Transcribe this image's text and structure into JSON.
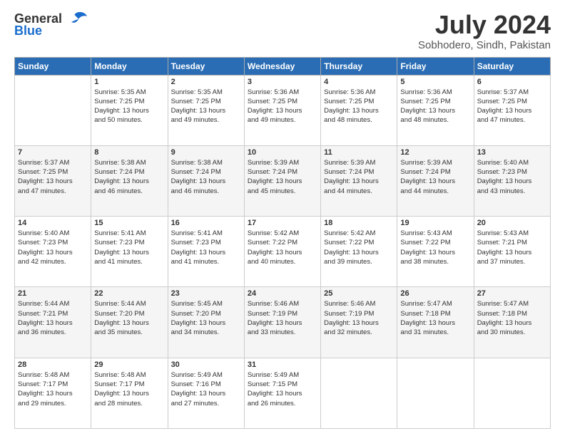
{
  "logo": {
    "general": "General",
    "blue": "Blue"
  },
  "title": {
    "month_year": "July 2024",
    "location": "Sobhodero, Sindh, Pakistan"
  },
  "weekdays": [
    "Sunday",
    "Monday",
    "Tuesday",
    "Wednesday",
    "Thursday",
    "Friday",
    "Saturday"
  ],
  "weeks": [
    [
      {
        "day": "",
        "info": ""
      },
      {
        "day": "1",
        "info": "Sunrise: 5:35 AM\nSunset: 7:25 PM\nDaylight: 13 hours\nand 50 minutes."
      },
      {
        "day": "2",
        "info": "Sunrise: 5:35 AM\nSunset: 7:25 PM\nDaylight: 13 hours\nand 49 minutes."
      },
      {
        "day": "3",
        "info": "Sunrise: 5:36 AM\nSunset: 7:25 PM\nDaylight: 13 hours\nand 49 minutes."
      },
      {
        "day": "4",
        "info": "Sunrise: 5:36 AM\nSunset: 7:25 PM\nDaylight: 13 hours\nand 48 minutes."
      },
      {
        "day": "5",
        "info": "Sunrise: 5:36 AM\nSunset: 7:25 PM\nDaylight: 13 hours\nand 48 minutes."
      },
      {
        "day": "6",
        "info": "Sunrise: 5:37 AM\nSunset: 7:25 PM\nDaylight: 13 hours\nand 47 minutes."
      }
    ],
    [
      {
        "day": "7",
        "info": "Sunrise: 5:37 AM\nSunset: 7:25 PM\nDaylight: 13 hours\nand 47 minutes."
      },
      {
        "day": "8",
        "info": "Sunrise: 5:38 AM\nSunset: 7:24 PM\nDaylight: 13 hours\nand 46 minutes."
      },
      {
        "day": "9",
        "info": "Sunrise: 5:38 AM\nSunset: 7:24 PM\nDaylight: 13 hours\nand 46 minutes."
      },
      {
        "day": "10",
        "info": "Sunrise: 5:39 AM\nSunset: 7:24 PM\nDaylight: 13 hours\nand 45 minutes."
      },
      {
        "day": "11",
        "info": "Sunrise: 5:39 AM\nSunset: 7:24 PM\nDaylight: 13 hours\nand 44 minutes."
      },
      {
        "day": "12",
        "info": "Sunrise: 5:39 AM\nSunset: 7:24 PM\nDaylight: 13 hours\nand 44 minutes."
      },
      {
        "day": "13",
        "info": "Sunrise: 5:40 AM\nSunset: 7:23 PM\nDaylight: 13 hours\nand 43 minutes."
      }
    ],
    [
      {
        "day": "14",
        "info": "Sunrise: 5:40 AM\nSunset: 7:23 PM\nDaylight: 13 hours\nand 42 minutes."
      },
      {
        "day": "15",
        "info": "Sunrise: 5:41 AM\nSunset: 7:23 PM\nDaylight: 13 hours\nand 41 minutes."
      },
      {
        "day": "16",
        "info": "Sunrise: 5:41 AM\nSunset: 7:23 PM\nDaylight: 13 hours\nand 41 minutes."
      },
      {
        "day": "17",
        "info": "Sunrise: 5:42 AM\nSunset: 7:22 PM\nDaylight: 13 hours\nand 40 minutes."
      },
      {
        "day": "18",
        "info": "Sunrise: 5:42 AM\nSunset: 7:22 PM\nDaylight: 13 hours\nand 39 minutes."
      },
      {
        "day": "19",
        "info": "Sunrise: 5:43 AM\nSunset: 7:22 PM\nDaylight: 13 hours\nand 38 minutes."
      },
      {
        "day": "20",
        "info": "Sunrise: 5:43 AM\nSunset: 7:21 PM\nDaylight: 13 hours\nand 37 minutes."
      }
    ],
    [
      {
        "day": "21",
        "info": "Sunrise: 5:44 AM\nSunset: 7:21 PM\nDaylight: 13 hours\nand 36 minutes."
      },
      {
        "day": "22",
        "info": "Sunrise: 5:44 AM\nSunset: 7:20 PM\nDaylight: 13 hours\nand 35 minutes."
      },
      {
        "day": "23",
        "info": "Sunrise: 5:45 AM\nSunset: 7:20 PM\nDaylight: 13 hours\nand 34 minutes."
      },
      {
        "day": "24",
        "info": "Sunrise: 5:46 AM\nSunset: 7:19 PM\nDaylight: 13 hours\nand 33 minutes."
      },
      {
        "day": "25",
        "info": "Sunrise: 5:46 AM\nSunset: 7:19 PM\nDaylight: 13 hours\nand 32 minutes."
      },
      {
        "day": "26",
        "info": "Sunrise: 5:47 AM\nSunset: 7:18 PM\nDaylight: 13 hours\nand 31 minutes."
      },
      {
        "day": "27",
        "info": "Sunrise: 5:47 AM\nSunset: 7:18 PM\nDaylight: 13 hours\nand 30 minutes."
      }
    ],
    [
      {
        "day": "28",
        "info": "Sunrise: 5:48 AM\nSunset: 7:17 PM\nDaylight: 13 hours\nand 29 minutes."
      },
      {
        "day": "29",
        "info": "Sunrise: 5:48 AM\nSunset: 7:17 PM\nDaylight: 13 hours\nand 28 minutes."
      },
      {
        "day": "30",
        "info": "Sunrise: 5:49 AM\nSunset: 7:16 PM\nDaylight: 13 hours\nand 27 minutes."
      },
      {
        "day": "31",
        "info": "Sunrise: 5:49 AM\nSunset: 7:15 PM\nDaylight: 13 hours\nand 26 minutes."
      },
      {
        "day": "",
        "info": ""
      },
      {
        "day": "",
        "info": ""
      },
      {
        "day": "",
        "info": ""
      }
    ]
  ]
}
